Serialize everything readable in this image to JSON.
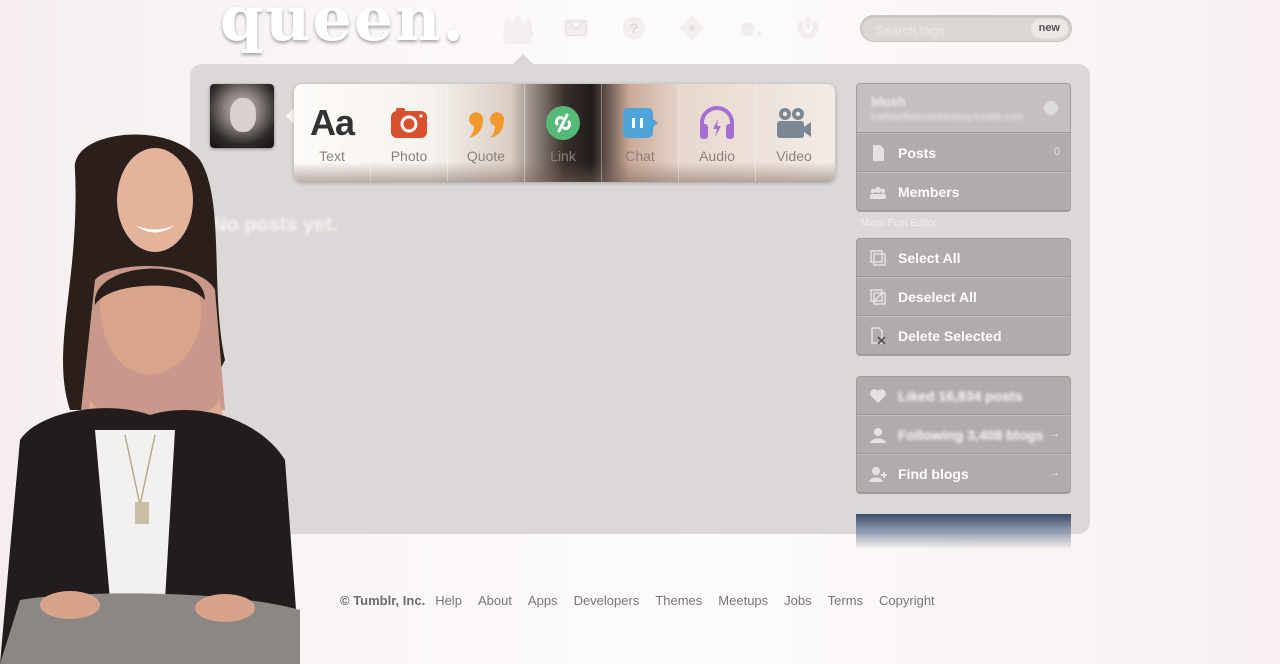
{
  "logo": "queen.",
  "nav": [
    {
      "name": "crown-icon"
    },
    {
      "name": "mail-icon"
    },
    {
      "name": "help-icon"
    },
    {
      "name": "gear-icon"
    },
    {
      "name": "edit-icon"
    },
    {
      "name": "power-icon"
    }
  ],
  "search": {
    "placeholder": "Search tags",
    "badge": "new"
  },
  "post_types": [
    {
      "label": "Text",
      "icon": "text-icon"
    },
    {
      "label": "Photo",
      "icon": "camera-icon"
    },
    {
      "label": "Quote",
      "icon": "quote-icon"
    },
    {
      "label": "Link",
      "icon": "link-icon"
    },
    {
      "label": "Chat",
      "icon": "chat-icon"
    },
    {
      "label": "Audio",
      "icon": "headphones-icon"
    },
    {
      "label": "Video",
      "icon": "video-camera-icon"
    }
  ],
  "main": {
    "empty_message": "No posts yet."
  },
  "sidebar": {
    "blog": {
      "name": "blush",
      "url": "kathnielforeverthestory.tumblr.com"
    },
    "blog_items": [
      {
        "label": "Posts",
        "count": "0",
        "icon": "document-icon"
      },
      {
        "label": "Members",
        "count": "",
        "icon": "members-icon"
      }
    ],
    "caption": "Mass Post Editor",
    "editor_items": [
      {
        "label": "Select All",
        "icon": "select-all-icon"
      },
      {
        "label": "Deselect All",
        "icon": "deselect-all-icon"
      },
      {
        "label": "Delete Selected",
        "icon": "delete-selected-icon"
      }
    ],
    "account_items": [
      {
        "label": "Liked 16,834 posts",
        "count": "",
        "icon": "heart-icon"
      },
      {
        "label": "Following 3,408 blogs",
        "count": "→",
        "icon": "user-icon"
      },
      {
        "label": "Find blogs",
        "count": "→",
        "icon": "add-user-icon"
      }
    ]
  },
  "footer": {
    "copyright": "© Tumblr, Inc.",
    "links": [
      "Help",
      "About",
      "Apps",
      "Developers",
      "Themes",
      "Meetups",
      "Jobs",
      "Terms",
      "Copyright"
    ]
  },
  "colors": {
    "panel": "#dcd8d7",
    "sidebar_item": "#b1acab",
    "photo_icon": "#d9502e",
    "quote_icon": "#f2992e",
    "link_icon": "#55b978",
    "chat_icon": "#4da4d8",
    "audio_icon": "#a46ed3",
    "video_icon": "#7b8793"
  }
}
